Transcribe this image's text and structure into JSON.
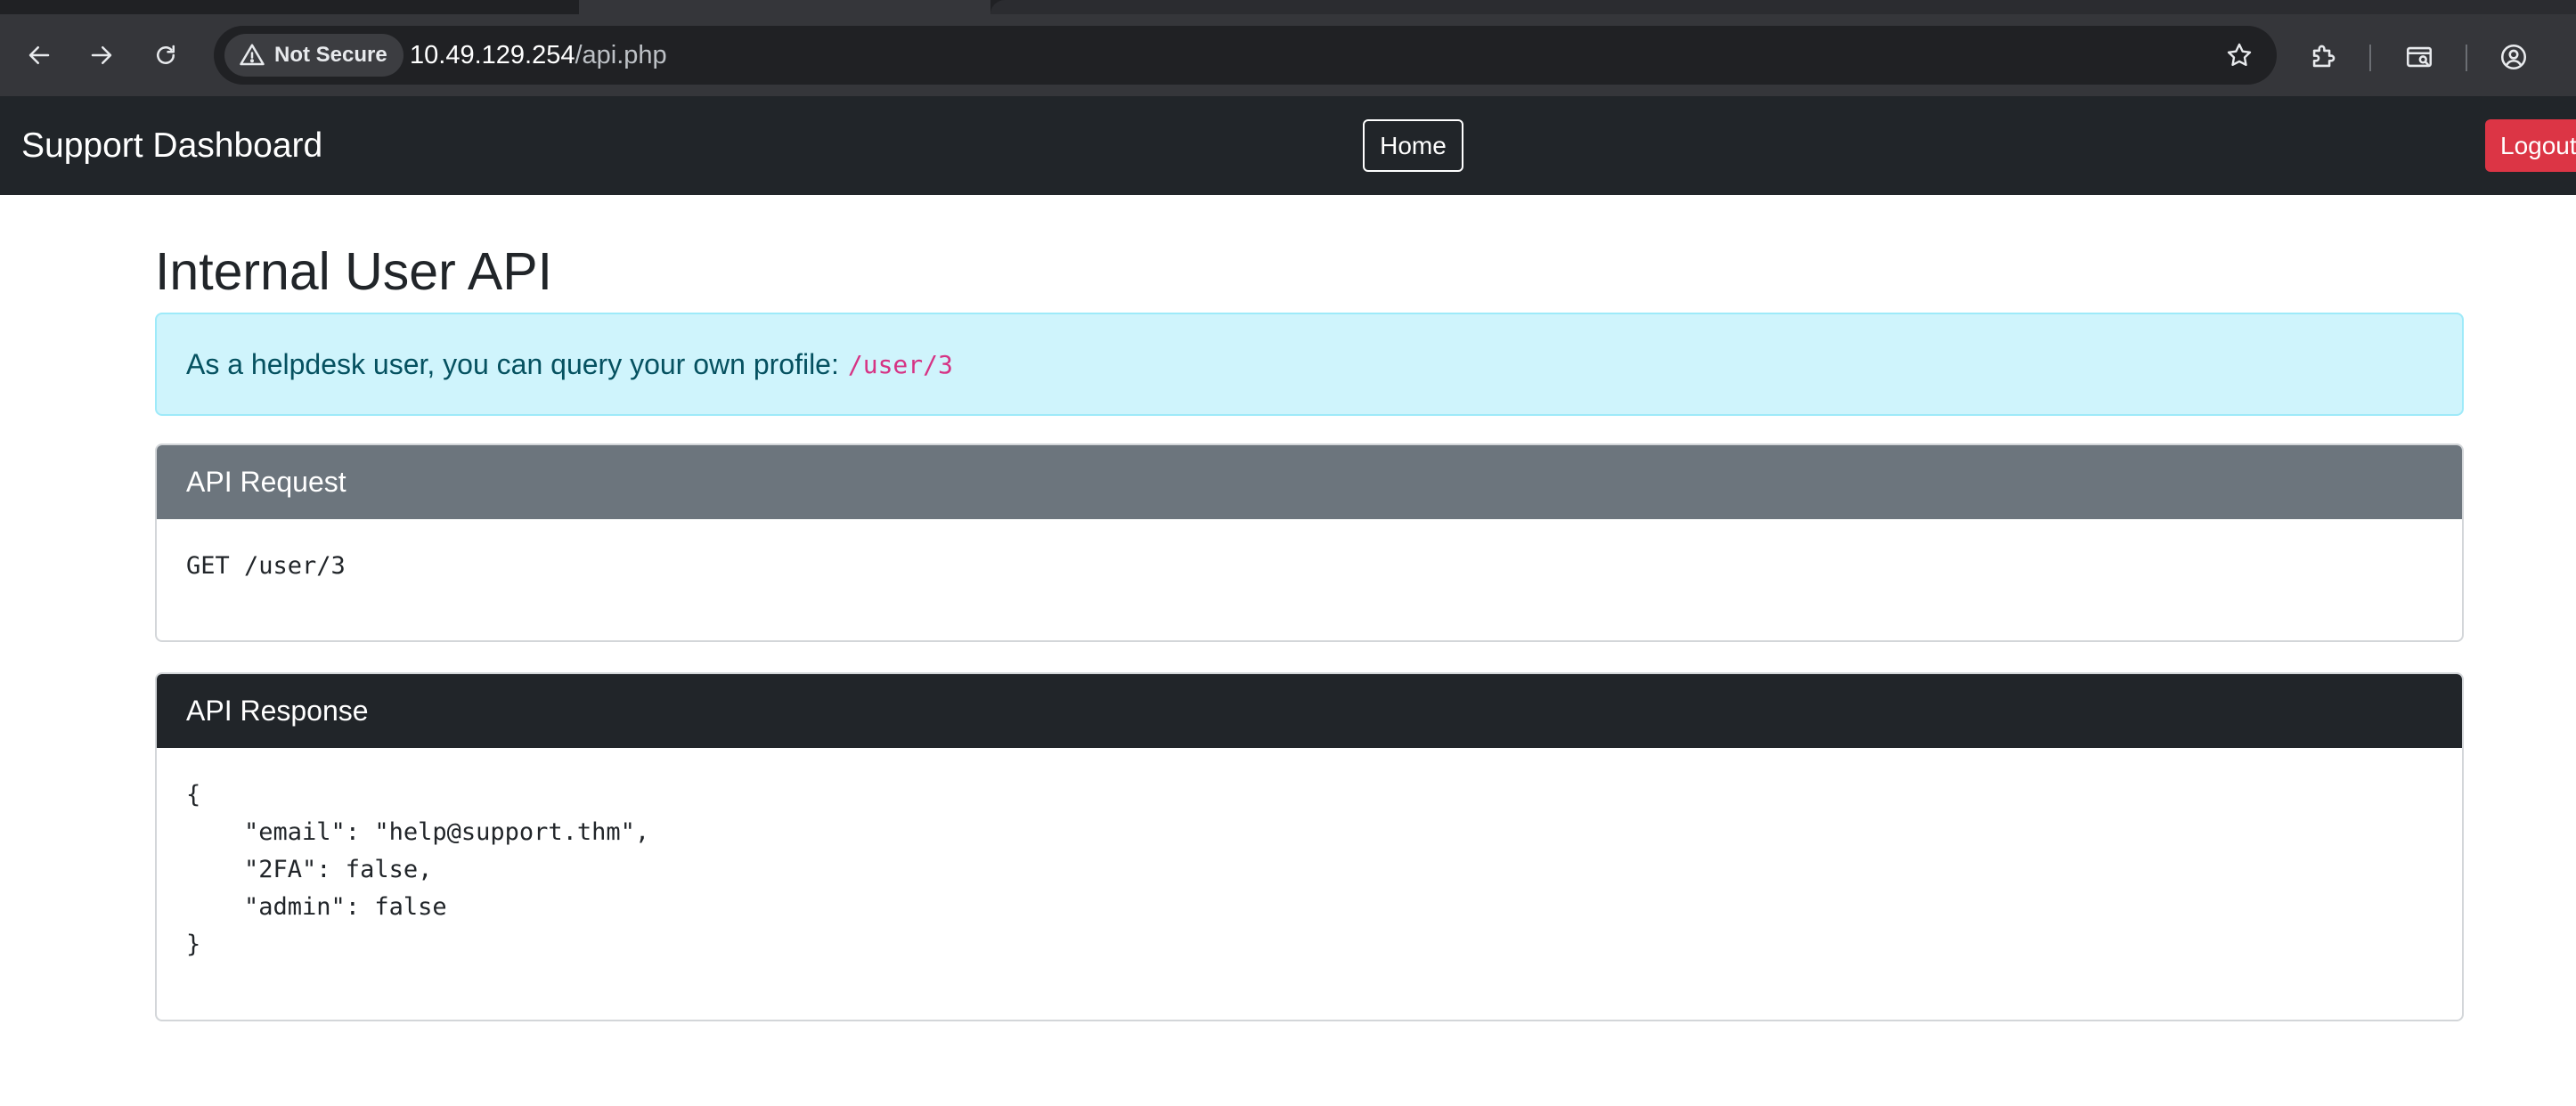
{
  "browser": {
    "security_label": "Not Secure",
    "url_host": "10.49.129.254",
    "url_path": "/api.php"
  },
  "navbar": {
    "brand": "Support Dashboard",
    "home_label": "Home",
    "logout_label": "Logout"
  },
  "page": {
    "title": "Internal User API",
    "info_text": "As a helpdesk user, you can query your own profile:",
    "info_code": "/user/3"
  },
  "request_card": {
    "header": "API Request",
    "body": "GET /user/3"
  },
  "response_card": {
    "header": "API Response",
    "body": "{\n    \"email\": \"help@support.thm\",\n    \"2FA\": false,\n    \"admin\": false\n}"
  },
  "colors": {
    "navbar_bg": "#212529",
    "logout_bg": "#dc3545",
    "info_bg": "#cff4fc",
    "info_code": "#d63384",
    "request_header_bg": "#6c757d",
    "response_header_bg": "#212529"
  },
  "icons": {
    "back": "arrow-left-icon",
    "forward": "arrow-right-icon",
    "reload": "reload-icon",
    "warning": "warning-triangle-icon",
    "bookmark": "star-icon",
    "extensions": "puzzle-icon",
    "tab_search": "tab-search-icon",
    "profile": "profile-icon"
  }
}
